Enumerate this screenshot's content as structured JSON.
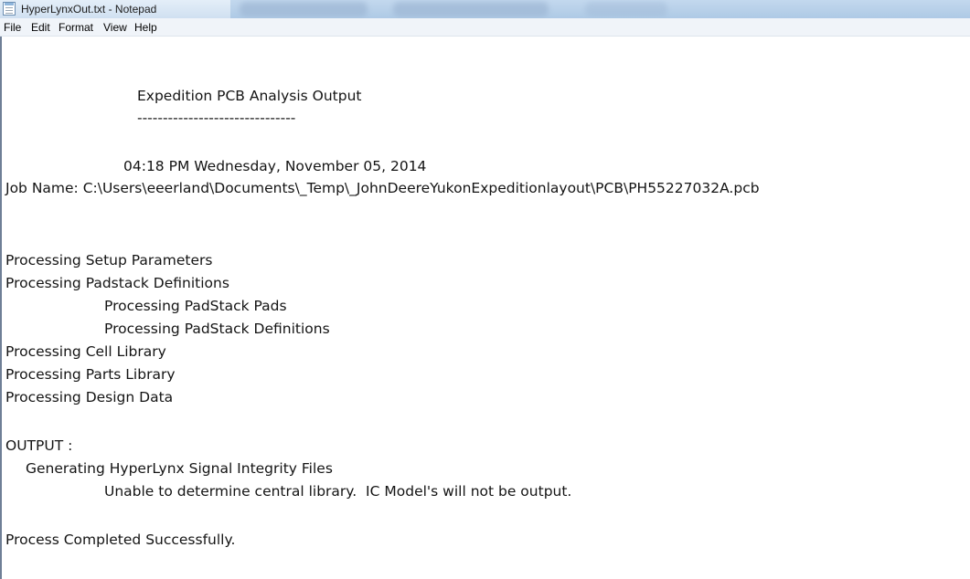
{
  "window": {
    "title": "HyperLynxOut.txt - Notepad"
  },
  "icons": {
    "app": "notepad-icon"
  },
  "menu": {
    "items": [
      {
        "label": "File"
      },
      {
        "label": "Edit"
      },
      {
        "label": "Format"
      },
      {
        "label": "View"
      },
      {
        "label": "Help"
      }
    ]
  },
  "document": {
    "lines": [
      {
        "text": "Expedition PCB Analysis Output"
      },
      {
        "text": "-------------------------------"
      },
      {
        "text": "04:18 PM Wednesday, November 05, 2014"
      },
      {
        "text": "Job Name: C:\\Users\\eeerland\\Documents\\_Temp\\_JohnDeereYukonExpeditionlayout\\PCB\\PH55227032A.pcb"
      },
      {
        "text": "Processing Setup Parameters"
      },
      {
        "text": "Processing Padstack Definitions"
      },
      {
        "text": "Processing PadStack Pads"
      },
      {
        "text": "Processing PadStack Definitions"
      },
      {
        "text": "Processing Cell Library"
      },
      {
        "text": "Processing Parts Library"
      },
      {
        "text": "Processing Design Data"
      },
      {
        "text": "OUTPUT :"
      },
      {
        "text": "Generating HyperLynx Signal Integrity Files"
      },
      {
        "text": "Unable to determine central library.  IC Model's will not be output."
      },
      {
        "text": "Process Completed Successfully."
      }
    ]
  },
  "colors": {
    "titlebar": "#b0cbe6",
    "menubar": "#f0f4f9",
    "text": "#141414",
    "editor_border": "#6f7f96"
  }
}
